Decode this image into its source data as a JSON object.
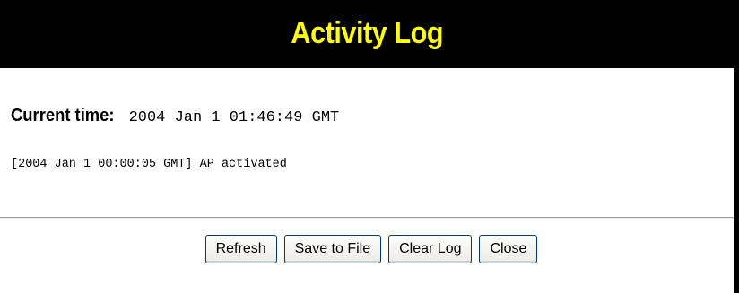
{
  "header": {
    "title": "Activity Log"
  },
  "current_time": {
    "label": "Current time:",
    "value": "2004 Jan 1 01:46:49 GMT"
  },
  "log": {
    "entries": [
      "[2004 Jan 1 00:00:05 GMT] AP activated"
    ]
  },
  "buttons": {
    "refresh": "Refresh",
    "save_to_file": "Save to File",
    "clear_log": "Clear Log",
    "close": "Close"
  },
  "colors": {
    "header_background": "#000000",
    "header_title": "#ffff00",
    "button_border": "#003c74"
  }
}
